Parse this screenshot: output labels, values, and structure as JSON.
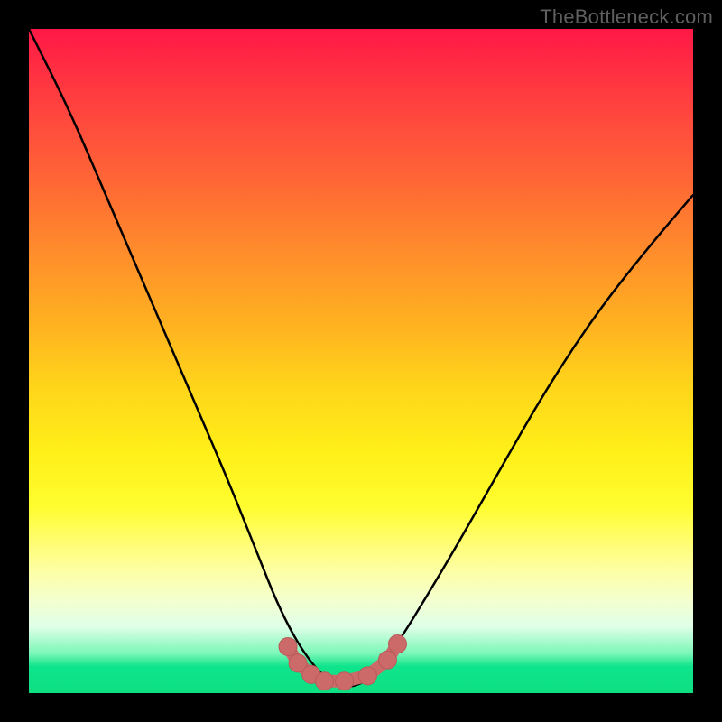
{
  "watermark": "TheBottleneck.com",
  "chart_data": {
    "type": "line",
    "title": "",
    "xlabel": "",
    "ylabel": "",
    "xlim": [
      0,
      1
    ],
    "ylim": [
      0,
      1
    ],
    "note": "Axes are unlabeled; values are normalized. Curve depicts bottleneck severity (high = top/red, low = bottom/green) vs component balance. The background gradient maps y=1 to red and y=0 to green.",
    "series": [
      {
        "name": "bottleneck-curve",
        "x": [
          0.0,
          0.06,
          0.12,
          0.18,
          0.24,
          0.3,
          0.34,
          0.38,
          0.42,
          0.46,
          0.5,
          0.54,
          0.62,
          0.7,
          0.78,
          0.86,
          0.94,
          1.0
        ],
        "y": [
          1.0,
          0.88,
          0.74,
          0.6,
          0.46,
          0.32,
          0.22,
          0.12,
          0.05,
          0.01,
          0.01,
          0.05,
          0.18,
          0.32,
          0.46,
          0.58,
          0.68,
          0.75
        ]
      },
      {
        "name": "optimal-zone-markers",
        "x": [
          0.39,
          0.405,
          0.425,
          0.445,
          0.475,
          0.51,
          0.54,
          0.555
        ],
        "y": [
          0.07,
          0.045,
          0.028,
          0.018,
          0.018,
          0.026,
          0.05,
          0.074
        ]
      }
    ],
    "colors": {
      "curve": "#000000",
      "markers": "#cc6a6a",
      "marker_stroke": "#b85a5a"
    }
  }
}
